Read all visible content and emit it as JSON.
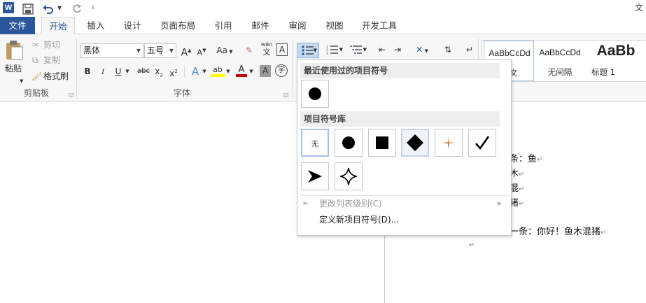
{
  "titlebar": {
    "app_icon": "W",
    "undo_icon": "undo-icon",
    "redo_icon": "redo-icon",
    "right_text": "文"
  },
  "tabs": [
    "文件",
    "开始",
    "插入",
    "设计",
    "页面布局",
    "引用",
    "邮件",
    "审阅",
    "视图",
    "开发工具"
  ],
  "clipboard": {
    "paste": "粘贴",
    "cut": "剪切",
    "copy": "复制",
    "format_painter": "格式刷",
    "label": "剪贴板"
  },
  "font": {
    "name": "黑体",
    "size": "五号",
    "label": "字体",
    "grow": "A",
    "shrink": "A",
    "case": "Aa",
    "phonetic": "wén",
    "phonetic_char": "文",
    "border_char": "A",
    "bold": "B",
    "italic": "I",
    "underline": "U",
    "strike": "abc",
    "sub": "x",
    "sup": "x",
    "effects": "A",
    "highlight": "ab",
    "color": "A",
    "shading": "A",
    "enclose": "字"
  },
  "styles": [
    {
      "sample": "AaBbCcDd",
      "name": "正文"
    },
    {
      "sample": "AaBbCcDd",
      "name": "无间隔"
    },
    {
      "sample": "AaBb",
      "name": "标题 1"
    }
  ],
  "bullet_panel": {
    "recent_header": "最近使用过的项目符号",
    "library_header": "项目符号库",
    "none_label": "无",
    "menu": [
      {
        "label": "更改列表级别(C)",
        "disabled": true
      },
      {
        "label": "定义新项目符号(D)...",
        "disabled": false
      }
    ]
  },
  "document": {
    "lines": [
      "条：鱼",
      "木",
      "混",
      "猪",
      "一条：你好！鱼木混猪",
      ""
    ]
  },
  "colors": {
    "accent": "#2b579a",
    "highlight_yellow": "#ffff00",
    "font_red": "#c00000"
  }
}
